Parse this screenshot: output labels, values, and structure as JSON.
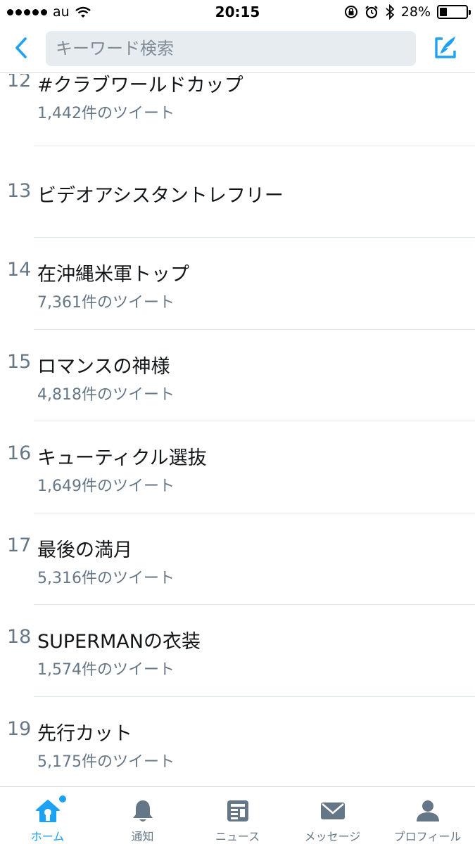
{
  "status_bar": {
    "carrier": "au",
    "time": "20:15",
    "battery": "28%",
    "battery_level": 0.28,
    "icons": [
      "signal-dots-icon",
      "wifi-icon",
      "orientation-lock-icon",
      "alarm-icon",
      "bluetooth-icon",
      "battery-icon"
    ]
  },
  "nav": {
    "search_placeholder": "キーワード検索",
    "back_icon": "chevron-left-icon",
    "compose_icon": "compose-quill-icon"
  },
  "colors": {
    "accent": "#1da1f2",
    "secondary_text": "#657786",
    "primary_text": "#14171a",
    "search_bg": "#e6ecf0"
  },
  "trends": [
    {
      "rank": "12",
      "name": "#クラブワールドカップ",
      "count": "1,442件のツイート"
    },
    {
      "rank": "13",
      "name": "ビデオアシスタントレフリー",
      "count": ""
    },
    {
      "rank": "14",
      "name": "在沖縄米軍トップ",
      "count": "7,361件のツイート"
    },
    {
      "rank": "15",
      "name": "ロマンスの神様",
      "count": "4,818件のツイート"
    },
    {
      "rank": "16",
      "name": "キューティクル選抜",
      "count": "1,649件のツイート"
    },
    {
      "rank": "17",
      "name": "最後の満月",
      "count": "5,316件のツイート"
    },
    {
      "rank": "18",
      "name": "SUPERMANの衣装",
      "count": "1,574件のツイート"
    },
    {
      "rank": "19",
      "name": "先行カット",
      "count": "5,175件のツイート"
    }
  ],
  "tabs": [
    {
      "label": "ホーム",
      "icon": "home-icon",
      "active": true,
      "has_badge": true
    },
    {
      "label": "通知",
      "icon": "bell-icon",
      "active": false
    },
    {
      "label": "ニュース",
      "icon": "news-icon",
      "active": false
    },
    {
      "label": "メッセージ",
      "icon": "envelope-icon",
      "active": false
    },
    {
      "label": "プロフィール",
      "icon": "profile-icon",
      "active": false
    }
  ]
}
